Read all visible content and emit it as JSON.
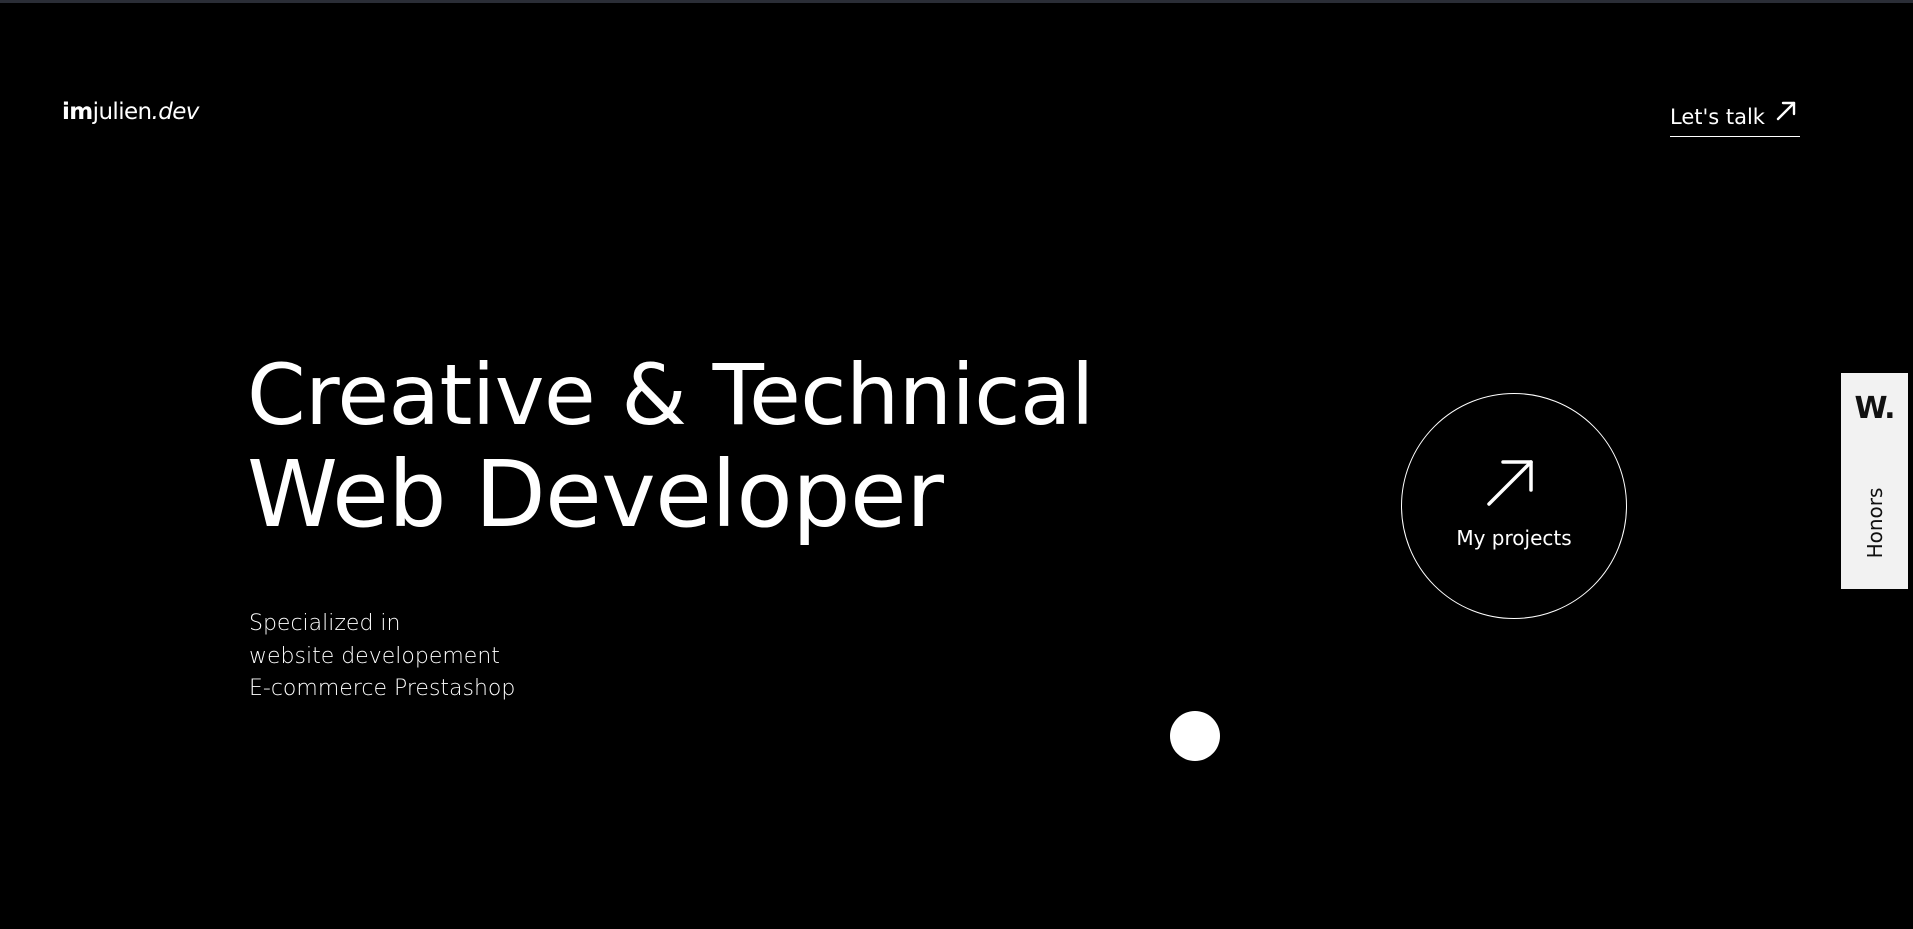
{
  "header": {
    "logo": {
      "bold": "im",
      "regular": "julien",
      "italic": ".dev"
    },
    "cta_label": "Let's talk",
    "cta_icon": "arrow-up-right-icon"
  },
  "hero": {
    "title_line1": "Creative & Technical",
    "title_line2": "Web Developer",
    "subtitle_lines": [
      "Specialized in",
      "website developement",
      "E-commerce Prestashop"
    ]
  },
  "projects_button": {
    "label": "My projects",
    "icon": "arrow-up-right-icon"
  },
  "honors_badge": {
    "mark": "W.",
    "label": "Honors"
  },
  "colors": {
    "background": "#000000",
    "foreground": "#ffffff",
    "badge_background": "#f2f2f2",
    "top_bar": "#2a2d36"
  }
}
